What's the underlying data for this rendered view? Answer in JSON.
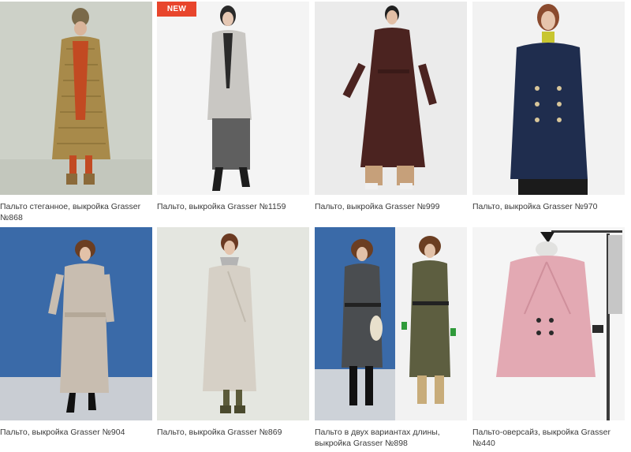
{
  "products": [
    {
      "caption": "Пальто стеганное, выкройка Grasser №868",
      "badge": "",
      "icon": "quilted-coat-photo"
    },
    {
      "caption": "Пальто, выкройка Grasser №1159",
      "badge": "NEW",
      "icon": "grey-coat-photo"
    },
    {
      "caption": "Пальто, выкройка Grasser №999",
      "badge": "",
      "icon": "trench-coat-photo"
    },
    {
      "caption": "Пальто, выкройка Grasser №970",
      "badge": "",
      "icon": "navy-peacoat-photo"
    },
    {
      "caption": "Пальто, выкройка Grasser №904",
      "badge": "",
      "icon": "belted-coat-photo"
    },
    {
      "caption": "Пальто, выкройка Grasser №869",
      "badge": "",
      "icon": "wrap-coat-photo"
    },
    {
      "caption": "Пальто в двух вариантах длины, выкройка Grasser №898",
      "badge": "",
      "icon": "two-length-coat-photo"
    },
    {
      "caption": "Пальто-оверсайз, выкройка Grasser №440",
      "badge": "",
      "icon": "pink-oversize-coat-photo"
    }
  ]
}
